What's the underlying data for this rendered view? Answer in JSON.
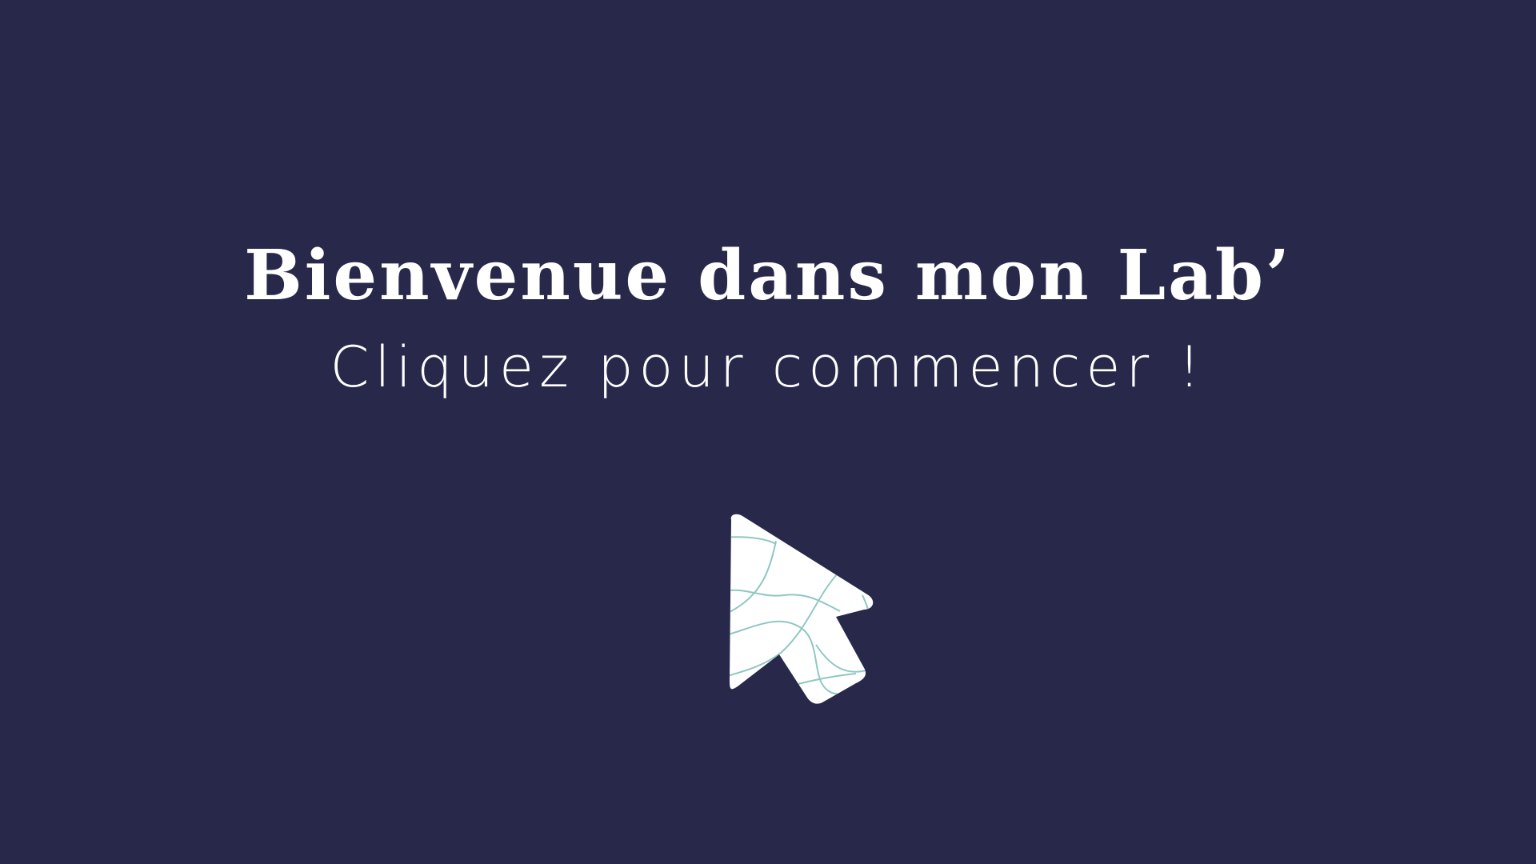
{
  "welcome": {
    "title": "Bienvenue dans mon Lab’",
    "subtitle": "Cliquez pour commencer !"
  },
  "cursor": {
    "icon": "mouse-pointer-icon"
  },
  "colors": {
    "background": "#28294a",
    "text": "#ffffff",
    "cursor_fill": "#ffffff",
    "cursor_lines": "#8fc7c2"
  }
}
